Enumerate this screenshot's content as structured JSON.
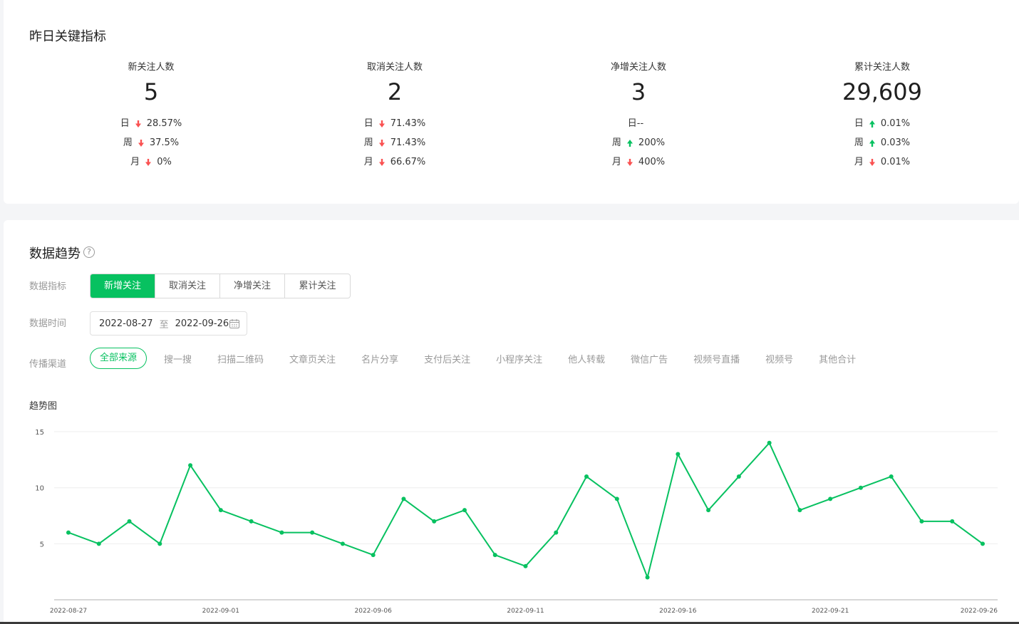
{
  "key_metrics": {
    "title": "昨日关键指标",
    "items": [
      {
        "label": "新关注人数",
        "value": "5",
        "rows": [
          {
            "period": "日",
            "dir": "down",
            "value": "28.57%"
          },
          {
            "period": "周",
            "dir": "down",
            "value": "37.5%"
          },
          {
            "period": "月",
            "dir": "down",
            "value": "0%"
          }
        ]
      },
      {
        "label": "取消关注人数",
        "value": "2",
        "rows": [
          {
            "period": "日",
            "dir": "down",
            "value": "71.43%"
          },
          {
            "period": "周",
            "dir": "down",
            "value": "71.43%"
          },
          {
            "period": "月",
            "dir": "down",
            "value": "66.67%"
          }
        ]
      },
      {
        "label": "净增关注人数",
        "value": "3",
        "rows": [
          {
            "period": "日--",
            "dir": "none",
            "value": ""
          },
          {
            "period": "周",
            "dir": "up",
            "value": "200%"
          },
          {
            "period": "月",
            "dir": "down",
            "value": "400%"
          }
        ]
      },
      {
        "label": "累计关注人数",
        "value": "29,609",
        "rows": [
          {
            "period": "日",
            "dir": "up",
            "value": "0.01%"
          },
          {
            "period": "周",
            "dir": "up",
            "value": "0.03%"
          },
          {
            "period": "月",
            "dir": "down",
            "value": "0.01%"
          }
        ]
      }
    ]
  },
  "trend": {
    "title": "数据趋势",
    "help_icon": "?",
    "metric_label": "数据指标",
    "metrics": [
      "新增关注",
      "取消关注",
      "净增关注",
      "累计关注"
    ],
    "active_metric": 0,
    "time_label": "数据时间",
    "date_from": "2022-08-27",
    "date_sep": "至",
    "date_to": "2022-09-26",
    "channel_label": "传播渠道",
    "channels": [
      "全部来源",
      "搜一搜",
      "扫描二维码",
      "文章页关注",
      "名片分享",
      "支付后关注",
      "小程序关注",
      "他人转载",
      "微信广告",
      "视频号直播",
      "视频号",
      "其他合计"
    ],
    "active_channel": 0,
    "chart_title": "趋势图"
  },
  "colors": {
    "brand": "#07c160",
    "down": "#fa5151",
    "up": "#07c160"
  },
  "chart_data": {
    "type": "line",
    "x": [
      "2022-08-27",
      "2022-08-28",
      "2022-08-29",
      "2022-08-30",
      "2022-08-31",
      "2022-09-01",
      "2022-09-02",
      "2022-09-03",
      "2022-09-04",
      "2022-09-05",
      "2022-09-06",
      "2022-09-07",
      "2022-09-08",
      "2022-09-09",
      "2022-09-10",
      "2022-09-11",
      "2022-09-12",
      "2022-09-13",
      "2022-09-14",
      "2022-09-15",
      "2022-09-16",
      "2022-09-17",
      "2022-09-18",
      "2022-09-19",
      "2022-09-20",
      "2022-09-21",
      "2022-09-22",
      "2022-09-23",
      "2022-09-24",
      "2022-09-25",
      "2022-09-26"
    ],
    "series": [
      {
        "values": [
          6,
          5,
          7,
          5,
          12,
          8,
          7,
          6,
          6,
          5,
          4,
          9,
          7,
          8,
          4,
          3,
          6,
          11,
          9,
          2,
          13,
          8,
          11,
          14,
          8,
          9,
          10,
          11,
          7,
          7,
          5
        ]
      }
    ],
    "x_tick_labels": [
      "2022-08-27",
      "2022-09-01",
      "2022-09-06",
      "2022-09-11",
      "2022-09-16",
      "2022-09-21",
      "2022-09-26"
    ],
    "y_ticks": [
      5,
      10,
      15
    ],
    "ylim": [
      0,
      15
    ],
    "grid": true,
    "color": "#07c160"
  }
}
